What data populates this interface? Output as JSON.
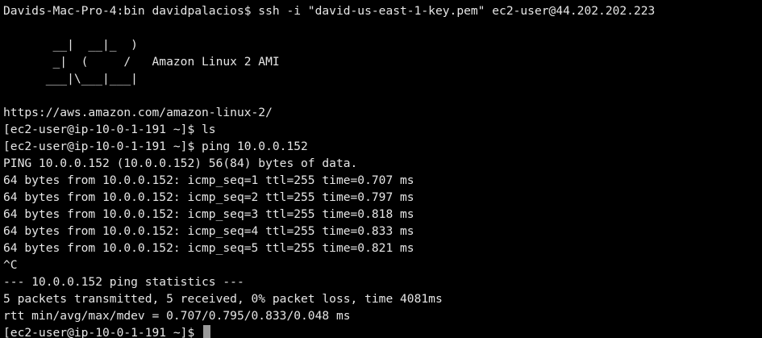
{
  "terminal": {
    "lines": [
      "Davids-Mac-Pro-4:bin davidpalacios$ ssh -i \"david-us-east-1-key.pem\" ec2-user@44.202.202.223",
      "",
      "       __|  __|_  )",
      "       _|  (     /   Amazon Linux 2 AMI",
      "      ___|\\___|___|",
      "",
      "https://aws.amazon.com/amazon-linux-2/",
      "[ec2-user@ip-10-0-1-191 ~]$ ls",
      "[ec2-user@ip-10-0-1-191 ~]$ ping 10.0.0.152",
      "PING 10.0.0.152 (10.0.0.152) 56(84) bytes of data.",
      "64 bytes from 10.0.0.152: icmp_seq=1 ttl=255 time=0.707 ms",
      "64 bytes from 10.0.0.152: icmp_seq=2 ttl=255 time=0.797 ms",
      "64 bytes from 10.0.0.152: icmp_seq=3 ttl=255 time=0.818 ms",
      "64 bytes from 10.0.0.152: icmp_seq=4 ttl=255 time=0.833 ms",
      "64 bytes from 10.0.0.152: icmp_seq=5 ttl=255 time=0.821 ms",
      "^C",
      "--- 10.0.0.152 ping statistics ---",
      "5 packets transmitted, 5 received, 0% packet loss, time 4081ms",
      "rtt min/avg/max/mdev = 0.707/0.795/0.833/0.048 ms"
    ],
    "prompt": "[ec2-user@ip-10-0-1-191 ~]$ ",
    "colors": {
      "background": "#000000",
      "foreground": "#e6e6e6",
      "cursor": "#9a9a9a"
    }
  }
}
